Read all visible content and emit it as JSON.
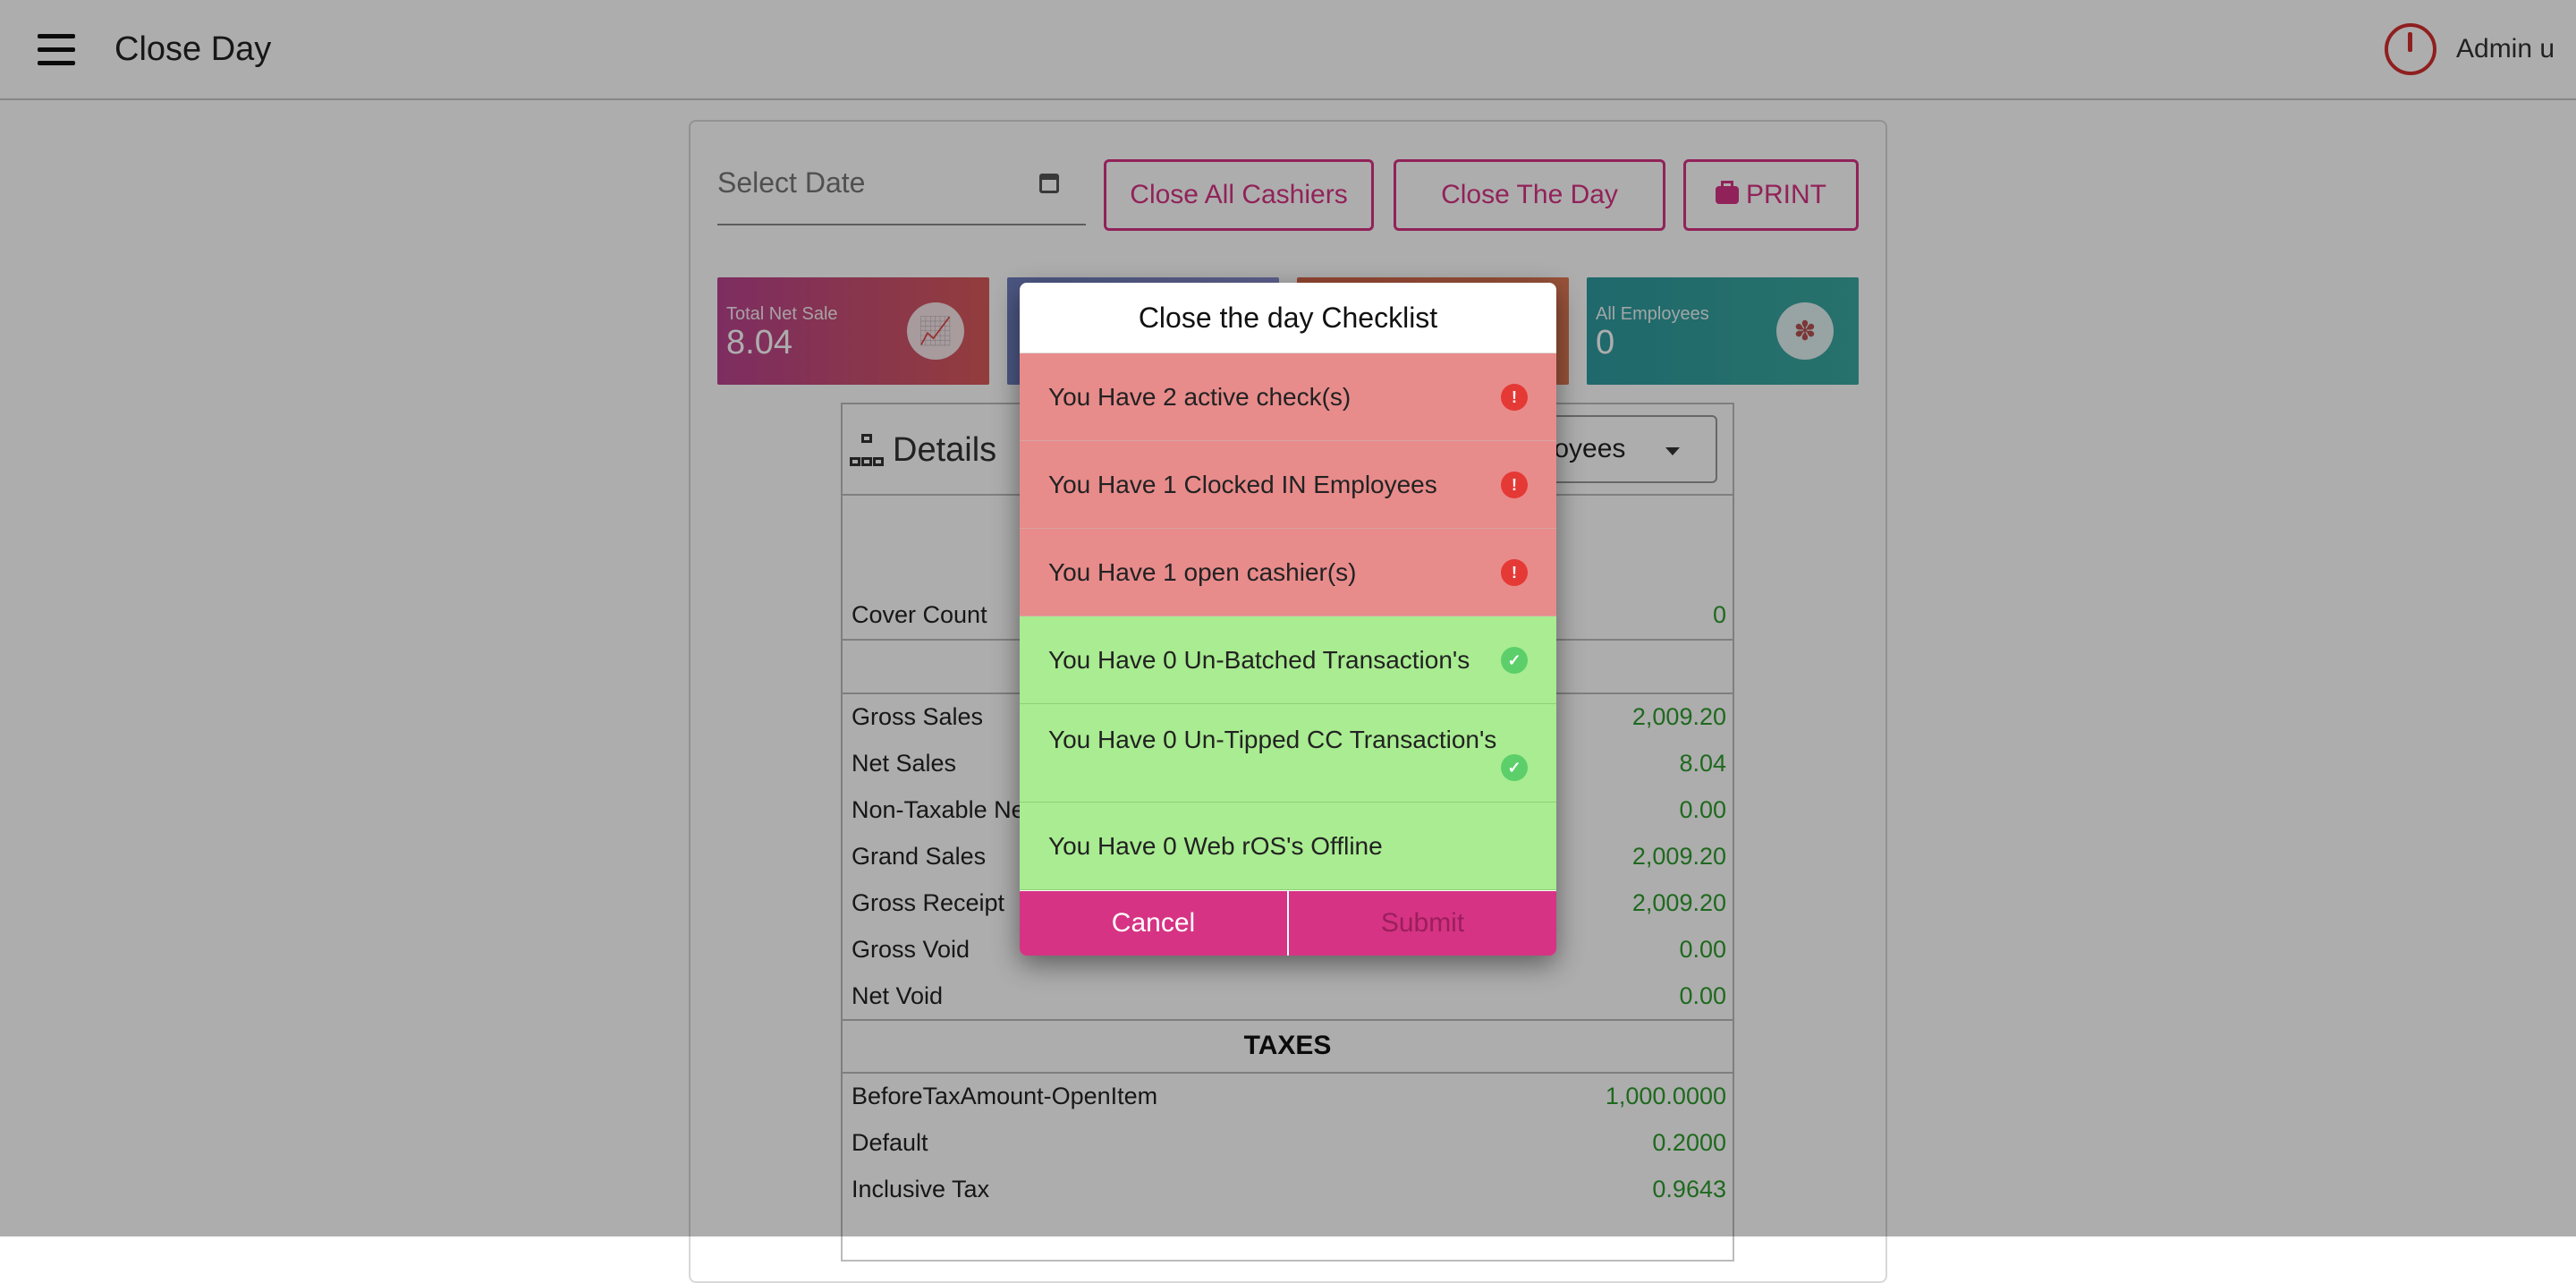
{
  "header": {
    "title": "Close Day",
    "user": "Admin u"
  },
  "toolbar": {
    "date_placeholder": "Select Date",
    "close_all_cashiers": "Close All Cashiers",
    "close_the_day": "Close The Day",
    "print": "PRINT"
  },
  "tiles": [
    {
      "label": "Total Net Sale",
      "value": "8.04",
      "color": "#c2407a"
    },
    {
      "label": "",
      "value": "",
      "color": "#6f7fc0"
    },
    {
      "label": "",
      "value": "",
      "color": "#d9674a"
    },
    {
      "label": "All Employees",
      "value": "0",
      "color": "#2f9aa0"
    }
  ],
  "details": {
    "title": "Details",
    "employee_select": "ployees",
    "rows": [
      {
        "label": "Cover Count",
        "value": "0"
      },
      {
        "label": "Gross Sales",
        "value": "2,009.20"
      },
      {
        "label": "Net Sales",
        "value": "8.04"
      },
      {
        "label": "Non-Taxable Ne",
        "value": "0.00"
      },
      {
        "label": "Grand Sales",
        "value": "2,009.20"
      },
      {
        "label": "Gross Receipt",
        "value": "2,009.20"
      },
      {
        "label": "Gross Void",
        "value": "0.00"
      },
      {
        "label": "Net Void",
        "value": "0.00"
      }
    ],
    "taxes_title": "TAXES",
    "tax_rows": [
      {
        "label": "BeforeTaxAmount-OpenItem",
        "value": "1,000.0000"
      },
      {
        "label": "Default",
        "value": "0.2000"
      },
      {
        "label": "Inclusive Tax",
        "value": "0.9643"
      }
    ]
  },
  "dialog": {
    "title": "Close the day Checklist",
    "items": [
      {
        "text": "You Have 2 active check(s)",
        "status": "error"
      },
      {
        "text": "You Have 1 Clocked IN Employees",
        "status": "error"
      },
      {
        "text": "You Have 1 open cashier(s)",
        "status": "error"
      },
      {
        "text": "You Have 0 Un-Batched Transaction's",
        "status": "ok"
      },
      {
        "text": "You Have 0 Un-Tipped CC Transaction's",
        "status": "ok"
      },
      {
        "text": "You Have 0 Web rOS's Offline",
        "status": "none"
      }
    ],
    "cancel": "Cancel",
    "submit": "Submit"
  }
}
